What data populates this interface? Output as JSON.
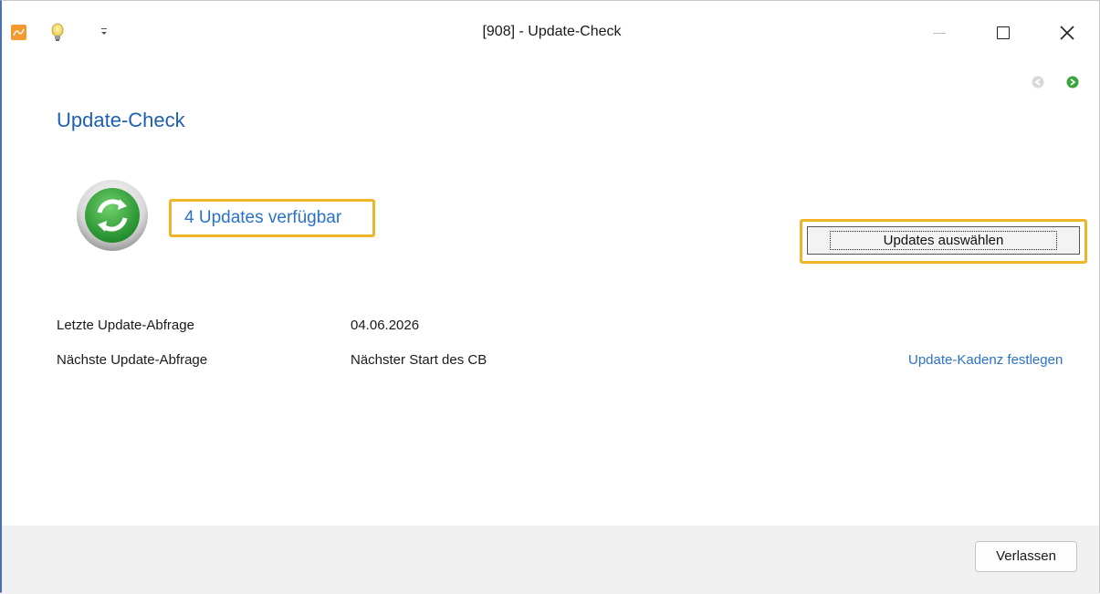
{
  "window": {
    "title": "[908] - Update-Check",
    "icons": [
      "app-logo-icon",
      "lightbulb-icon",
      "quick-access-menu-icon",
      "minimize-icon",
      "maximize-icon",
      "close-icon",
      "back-arrow-icon",
      "forward-arrow-icon"
    ]
  },
  "main": {
    "heading": "Update-Check",
    "status_icon": "refresh-icon",
    "updates_available_link": "4 Updates verfügbar",
    "select_updates_button": "Updates auswählen",
    "rows": [
      {
        "label": "Letzte Update-Abfrage",
        "value": "04.06.2026"
      },
      {
        "label": "Nächste Update-Abfrage",
        "value": "Nächster Start des CB"
      }
    ],
    "cadence_link": "Update-Kadenz festlegen"
  },
  "footer": {
    "exit_button": "Verlassen"
  },
  "colors": {
    "accent_link": "#2a72c8",
    "heading": "#1f5fb3",
    "highlight_outline": "#f0b429",
    "refresh_green": "#3aa53a"
  }
}
